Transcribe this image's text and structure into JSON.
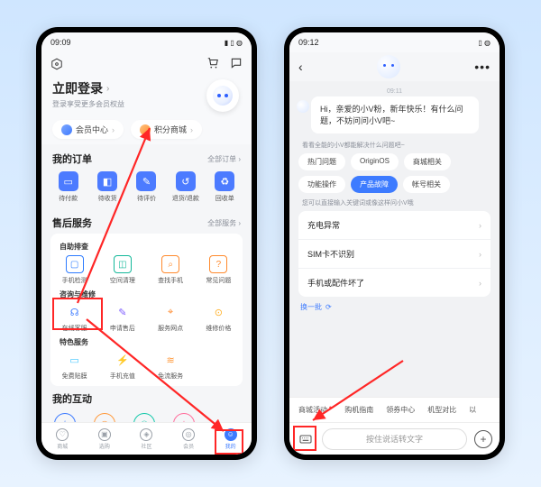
{
  "left": {
    "status": {
      "time": "09:09",
      "icons": "◉ ⟟ ⬥ ⬤",
      "right": "▮ ▯ ◍"
    },
    "login_title": "立即登录",
    "login_sub": "登录享受更多会员权益",
    "chips": {
      "member": "会员中心",
      "points": "积分商城"
    },
    "orders": {
      "title": "我的订单",
      "more": "全部订单 ›",
      "items": [
        "待付款",
        "待收货",
        "待评价",
        "退货/退款",
        "回收单"
      ]
    },
    "service": {
      "title": "售后服务",
      "more": "全部服务 ›",
      "self_title": "自助排查",
      "self_items": [
        "手机检测",
        "空间清理",
        "查找手机",
        "常见问题"
      ],
      "consult_title": "咨询与维修",
      "consult_items": [
        "在线客服",
        "申请售后",
        "服务网点",
        "维修价格"
      ],
      "special_title": "特色服务",
      "special_items": [
        "免费贴膜",
        "手机充值",
        "免流服务"
      ]
    },
    "hudong_title": "我的互动",
    "nav": [
      "商城",
      "选购",
      "社区",
      "会员",
      "我的"
    ]
  },
  "right": {
    "status": {
      "time": "09:12",
      "icons": "◉ ⬥ ⬤ ⬤",
      "right": "▯ ◍"
    },
    "chat_time": "09:11",
    "greeting": "Hi，亲爱的小V粉，新年快乐！有什么问题，不妨问问小V吧~",
    "prompt1": "看看全能的小V都能解决什么问题吧~",
    "chips": [
      "热门问题",
      "OriginOS",
      "商城相关",
      "功能操作",
      "产品故障",
      "帐号相关"
    ],
    "prompt2": "您可以直接输入关键词或像这样问小V哦",
    "list": [
      "充电异常",
      "SIM卡不识别",
      "手机或配件坏了"
    ],
    "swap": "换一批",
    "scroll": [
      "商城活动",
      "购机指南",
      "领券中心",
      "机型对比",
      "以"
    ],
    "voice_hint": "按住说话转文字"
  }
}
